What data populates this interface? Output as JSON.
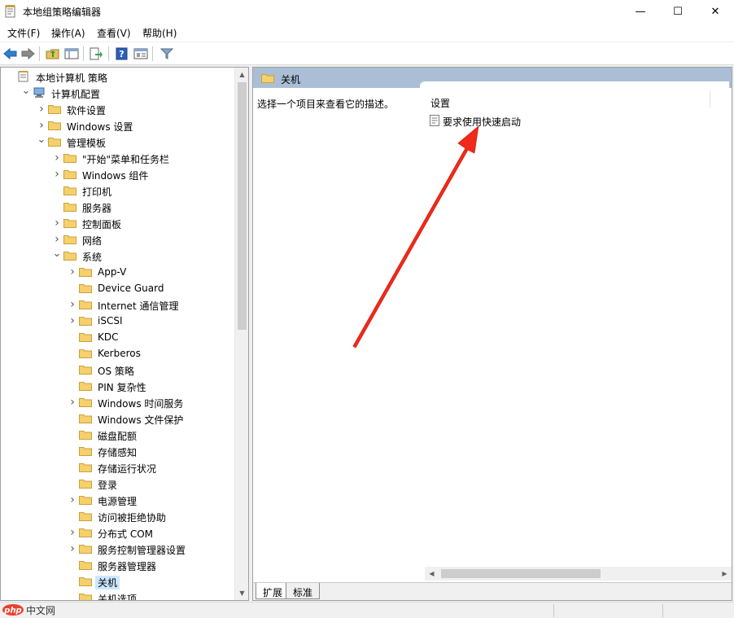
{
  "window": {
    "title": "本地组策略编辑器",
    "controls": {
      "minimize": "—",
      "maximize": "☐",
      "close": "✕"
    }
  },
  "menu": [
    "文件(F)",
    "操作(A)",
    "查看(V)",
    "帮助(H)"
  ],
  "toolbar": [
    "back-arrow-icon",
    "forward-arrow-icon",
    "up-folder-icon",
    "show-hide-tree-icon",
    "export-list-icon",
    "help-icon",
    "properties-icon",
    "filter-icon"
  ],
  "tree": [
    {
      "label": "本地计算机 策略",
      "depth": 0,
      "expander": "none",
      "icon": "policy-doc"
    },
    {
      "label": "计算机配置",
      "depth": 1,
      "expander": "open",
      "icon": "computer"
    },
    {
      "label": "软件设置",
      "depth": 2,
      "expander": "closed",
      "icon": "folder"
    },
    {
      "label": "Windows 设置",
      "depth": 2,
      "expander": "closed",
      "icon": "folder"
    },
    {
      "label": "管理模板",
      "depth": 2,
      "expander": "open",
      "icon": "folder"
    },
    {
      "label": "\"开始\"菜单和任务栏",
      "depth": 3,
      "expander": "closed",
      "icon": "folder"
    },
    {
      "label": "Windows 组件",
      "depth": 3,
      "expander": "closed",
      "icon": "folder"
    },
    {
      "label": "打印机",
      "depth": 3,
      "expander": "none",
      "icon": "folder"
    },
    {
      "label": "服务器",
      "depth": 3,
      "expander": "none",
      "icon": "folder"
    },
    {
      "label": "控制面板",
      "depth": 3,
      "expander": "closed",
      "icon": "folder"
    },
    {
      "label": "网络",
      "depth": 3,
      "expander": "closed",
      "icon": "folder"
    },
    {
      "label": "系统",
      "depth": 3,
      "expander": "open",
      "icon": "folder"
    },
    {
      "label": "App-V",
      "depth": 4,
      "expander": "closed",
      "icon": "folder"
    },
    {
      "label": "Device Guard",
      "depth": 4,
      "expander": "none",
      "icon": "folder"
    },
    {
      "label": "Internet 通信管理",
      "depth": 4,
      "expander": "closed",
      "icon": "folder"
    },
    {
      "label": "iSCSI",
      "depth": 4,
      "expander": "closed",
      "icon": "folder"
    },
    {
      "label": "KDC",
      "depth": 4,
      "expander": "none",
      "icon": "folder"
    },
    {
      "label": "Kerberos",
      "depth": 4,
      "expander": "none",
      "icon": "folder"
    },
    {
      "label": "OS 策略",
      "depth": 4,
      "expander": "none",
      "icon": "folder"
    },
    {
      "label": "PIN 复杂性",
      "depth": 4,
      "expander": "none",
      "icon": "folder"
    },
    {
      "label": "Windows 时间服务",
      "depth": 4,
      "expander": "closed",
      "icon": "folder"
    },
    {
      "label": "Windows 文件保护",
      "depth": 4,
      "expander": "none",
      "icon": "folder"
    },
    {
      "label": "磁盘配额",
      "depth": 4,
      "expander": "none",
      "icon": "folder"
    },
    {
      "label": "存储感知",
      "depth": 4,
      "expander": "none",
      "icon": "folder"
    },
    {
      "label": "存储运行状况",
      "depth": 4,
      "expander": "none",
      "icon": "folder"
    },
    {
      "label": "登录",
      "depth": 4,
      "expander": "none",
      "icon": "folder"
    },
    {
      "label": "电源管理",
      "depth": 4,
      "expander": "closed",
      "icon": "folder"
    },
    {
      "label": "访问被拒绝协助",
      "depth": 4,
      "expander": "none",
      "icon": "folder"
    },
    {
      "label": "分布式 COM",
      "depth": 4,
      "expander": "closed",
      "icon": "folder"
    },
    {
      "label": "服务控制管理器设置",
      "depth": 4,
      "expander": "closed",
      "icon": "folder"
    },
    {
      "label": "服务器管理器",
      "depth": 4,
      "expander": "none",
      "icon": "folder"
    },
    {
      "label": "关机",
      "depth": 4,
      "expander": "none",
      "icon": "folder",
      "selected": true
    },
    {
      "label": "关机选项",
      "depth": 4,
      "expander": "none",
      "icon": "folder"
    }
  ],
  "right": {
    "header": "关机",
    "description": "选择一个项目来查看它的描述。",
    "column_header": "设置",
    "settings": [
      "要求使用快速启动"
    ],
    "tabs": [
      "扩展",
      "标准"
    ],
    "active_tab": 0
  },
  "watermark": {
    "text": "php中文网"
  },
  "colors": {
    "header_bg": "#aabfd6",
    "selection": "#cce8ff",
    "folder": "#f5d06b",
    "arrow": "#f02a1a"
  }
}
